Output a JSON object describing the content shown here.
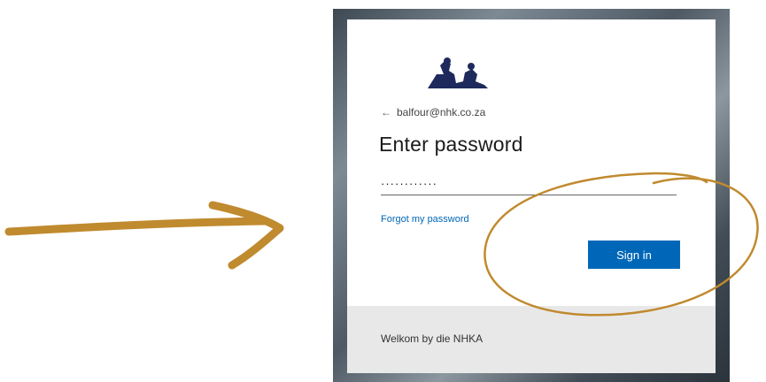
{
  "login": {
    "account": "balfour@nhk.co.za",
    "title": "Enter password",
    "password_value": "············",
    "forgot_link": "Forgot my password",
    "signin_label": "Sign in",
    "footer_text": "Welkom by die NHKA"
  },
  "icons": {
    "back": "back-arrow-icon",
    "logo": "org-logo-icon"
  },
  "colors": {
    "accent": "#0067b8",
    "annotation": "#c08a2e",
    "logo": "#1f2a5c"
  }
}
